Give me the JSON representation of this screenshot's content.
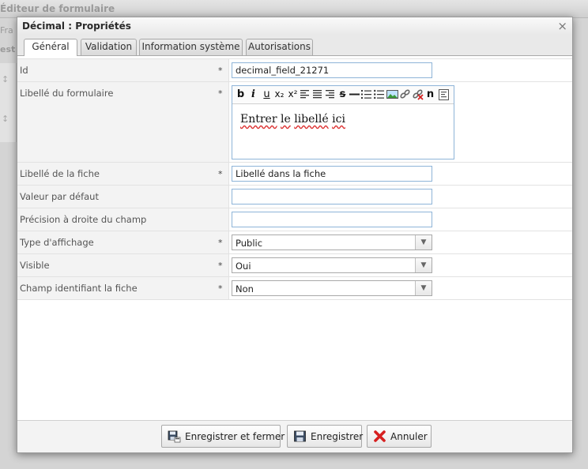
{
  "background": {
    "app_title": "Éditeur de formulaire",
    "tab_fragment": "Fra",
    "row_fragment": "est"
  },
  "dialog": {
    "title": "Décimal : Propriétés",
    "close_glyph": "×"
  },
  "tabs": [
    {
      "label": "Général",
      "active": true
    },
    {
      "label": "Validation",
      "active": false
    },
    {
      "label": "Information système",
      "active": false
    },
    {
      "label": "Autorisations",
      "active": false
    }
  ],
  "form": {
    "id": {
      "label": "Id",
      "required": "*",
      "value": "decimal_field_21271"
    },
    "form_label": {
      "label": "Libellé du formulaire",
      "required": "*",
      "editor_text": [
        "Entrer",
        "le",
        "libellé",
        "ici"
      ]
    },
    "sheet_label": {
      "label": "Libellé de la fiche",
      "required": "*",
      "value": "Libellé dans la fiche"
    },
    "default_value": {
      "label": "Valeur par défaut",
      "value": ""
    },
    "precision": {
      "label": "Précision à droite du champ",
      "value": ""
    },
    "display_type": {
      "label": "Type d'affichage",
      "required": "*",
      "selected": "Public"
    },
    "visible": {
      "label": "Visible",
      "required": "*",
      "selected": "Oui"
    },
    "identifying_field": {
      "label": "Champ identifiant la fiche",
      "required": "*",
      "selected": "Non"
    }
  },
  "editor_toolbar": {
    "bold": "b",
    "italic": "i",
    "underline": "u",
    "subscript": "x₂",
    "superscript": "x²",
    "strike": "s",
    "char_n": "n"
  },
  "buttons": {
    "save_close": "Enregistrer et fermer",
    "save": "Enregistrer",
    "cancel": "Annuler"
  },
  "colors": {
    "input_border": "#8eb4d8",
    "cancel_icon": "#d62020"
  }
}
